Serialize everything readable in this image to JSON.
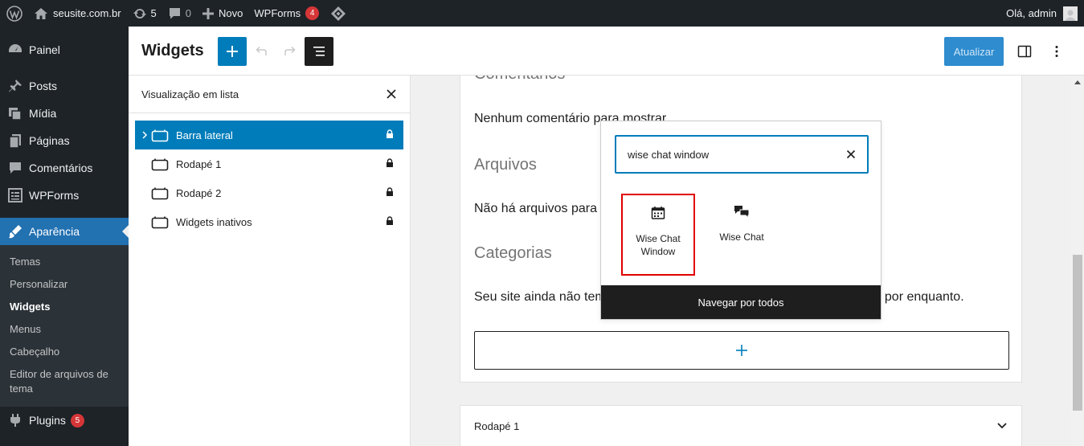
{
  "admin_bar": {
    "site_name": "seusite.com.br",
    "updates_count": "5",
    "comments_count": "0",
    "new_label": "Novo",
    "wpforms_label": "WPForms",
    "wpforms_badge": "4",
    "greeting": "Olá, admin"
  },
  "sidebar": {
    "items": [
      {
        "label": "Painel"
      },
      {
        "label": "Posts"
      },
      {
        "label": "Mídia"
      },
      {
        "label": "Páginas"
      },
      {
        "label": "Comentários"
      },
      {
        "label": "WPForms"
      },
      {
        "label": "Aparência"
      },
      {
        "label": "Plugins",
        "badge": "5"
      }
    ],
    "submenu": [
      "Temas",
      "Personalizar",
      "Widgets",
      "Menus",
      "Cabeçalho",
      "Editor de arquivos de tema"
    ]
  },
  "header": {
    "title": "Widgets",
    "update_label": "Atualizar"
  },
  "list_view": {
    "title": "Visualização em lista",
    "items": [
      "Barra lateral",
      "Rodapé 1",
      "Rodapé 2",
      "Widgets inativos"
    ]
  },
  "canvas": {
    "heading_comments": "Comentários",
    "comments_text": "Nenhum comentário para mostrar.",
    "heading_archives": "Arquivos",
    "archives_text": "Não há arquivos para",
    "heading_categories": "Categorias",
    "categories_text_left": "Seu site ainda não tem",
    "categories_text_right": "ui por enquanto.",
    "footer_card_label": "Rodapé 1"
  },
  "inserter": {
    "search_value": "wise chat window",
    "results": [
      "Wise Chat\nWindow",
      "Wise Chat"
    ],
    "browse_all_label": "Navegar por todos"
  },
  "colors": {
    "admin_dark": "#1d2327",
    "accent": "#007cba",
    "active_menu": "#2271b1",
    "highlight": "#e00000",
    "badge": "#d63638"
  }
}
